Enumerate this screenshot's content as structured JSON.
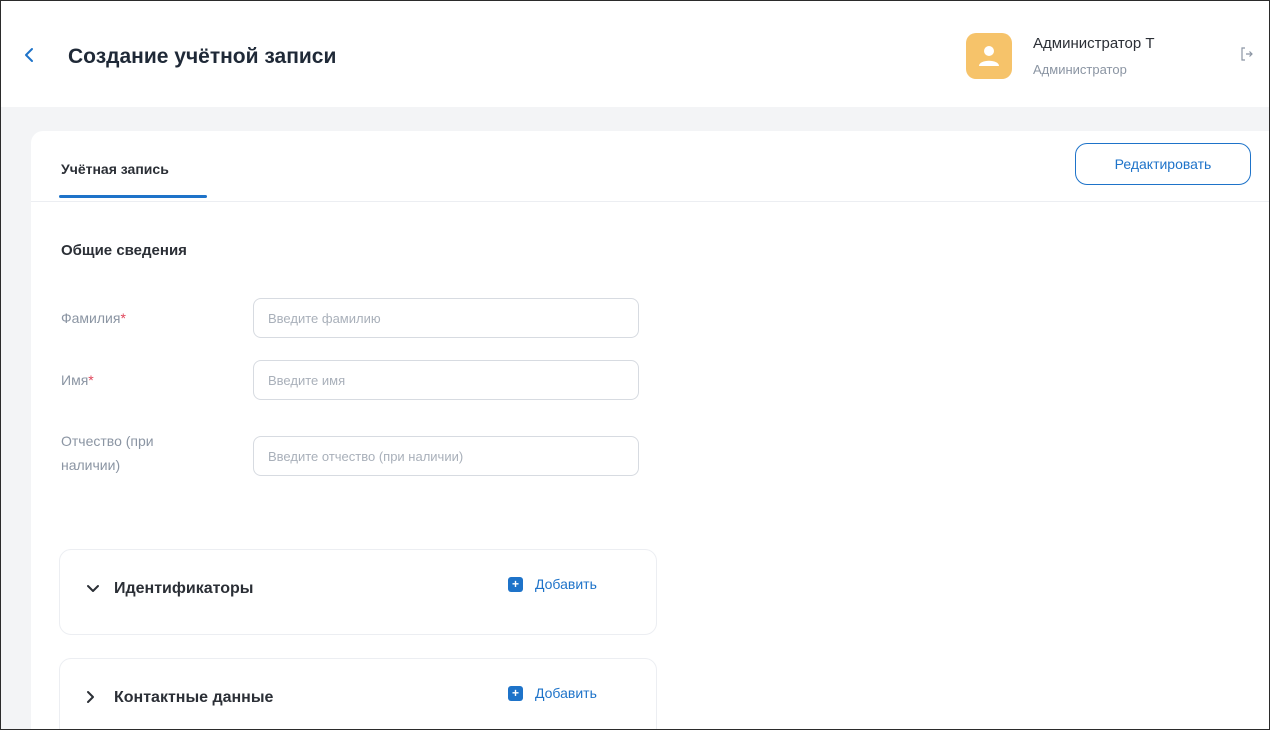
{
  "header": {
    "back_icon": "chevron-left-icon",
    "title": "Создание учётной записи",
    "user": {
      "name": "Администратор Т",
      "role": "Администратор",
      "avatar_icon": "user-icon",
      "avatar_color": "#f6c36a"
    },
    "logout_icon": "logout-icon"
  },
  "tabs": [
    {
      "label": "Учётная запись",
      "active": true
    }
  ],
  "actions": {
    "edit_label": "Редактировать"
  },
  "form": {
    "section_title": "Общие сведения",
    "fields": [
      {
        "label": "Фамилия",
        "required": true,
        "placeholder": "Введите фамилию",
        "value": ""
      },
      {
        "label": "Имя",
        "required": true,
        "placeholder": "Введите имя",
        "value": ""
      },
      {
        "label": "Отчество (при наличии)",
        "required": false,
        "placeholder": "Введите отчество (при наличии)",
        "value": ""
      }
    ]
  },
  "panels": [
    {
      "title": "Идентификаторы",
      "expanded": true,
      "add_label": "Добавить"
    },
    {
      "title": "Контактные данные",
      "expanded": false,
      "add_label": "Добавить"
    }
  ],
  "colors": {
    "accent": "#1e73c9",
    "required": "#e0455a"
  }
}
